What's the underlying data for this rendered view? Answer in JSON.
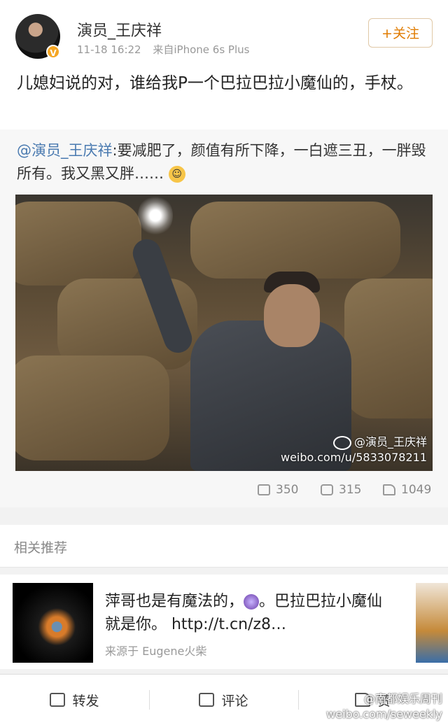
{
  "post": {
    "author": "演员_王庆祥",
    "verified_badge": "V",
    "time": "11-18 16:22",
    "source": "来自iPhone 6s Plus",
    "follow_label": "+关注",
    "text": "儿媳妇说的对，谁给我P一个巴拉巴拉小魔仙的，手杖。"
  },
  "repost": {
    "mention": "@演员_王庆祥",
    "text": ":要减肥了，颜值有所下降，一白遮三丑，一胖毁所有。我又黑又胖……",
    "emoji_icon": "shy-face-emoji",
    "watermark": {
      "handle": "@演员_王庆祥",
      "url": "weibo.com/u/5833078211"
    },
    "stats": {
      "reposts": "350",
      "comments": "315",
      "likes": "1049"
    }
  },
  "related": {
    "title": "相关推荐",
    "item": {
      "text_part1": "萍哥也是有魔法的，",
      "text_part2": "。巴拉巴拉小魔仙就是你。 http://t.cn/z8…",
      "source": "来源于 Eugene火柴"
    }
  },
  "bottom_bar": {
    "repost_label": "转发",
    "comment_label": "评论",
    "like_label": "赞"
  },
  "corner_watermark": {
    "line1": "@南都娱乐周刊",
    "line2": "weibo.com/seweekly"
  },
  "colors": {
    "follow_orange": "#e07b00",
    "mention_blue": "#4a7ab0",
    "verified_gold": "#f5a623"
  }
}
